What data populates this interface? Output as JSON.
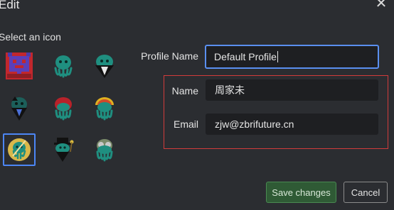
{
  "dialog": {
    "title": "Edit",
    "close_glyph": "✕"
  },
  "icons": {
    "label": "Select an icon",
    "items": [
      {
        "name": "pixel-creature-icon",
        "selected": false
      },
      {
        "name": "teal-squid-icon",
        "selected": false
      },
      {
        "name": "bearded-squid-icon",
        "selected": false
      },
      {
        "name": "dark-squid-icon",
        "selected": false
      },
      {
        "name": "red-squid-icon",
        "selected": false
      },
      {
        "name": "rainbow-squid-icon",
        "selected": false
      },
      {
        "name": "gold-squid-icon",
        "selected": true
      },
      {
        "name": "tophat-squid-icon",
        "selected": false
      },
      {
        "name": "goggles-squid-icon",
        "selected": false
      }
    ]
  },
  "form": {
    "profile_name_label": "Profile Name",
    "profile_name_value": "Default Profile",
    "name_label": "Name",
    "name_value": "周家未",
    "email_label": "Email",
    "email_value": "zjw@zbrifuture.cn"
  },
  "buttons": {
    "save_label": "Save changes",
    "cancel_label": "Cancel"
  },
  "colors": {
    "background": "#2b2d31",
    "input_bg": "#1e1f22",
    "focus_border": "#5a8ff0",
    "highlight_border": "#d23b3b",
    "save_bg": "#2f5a35",
    "save_border": "#4a8a52"
  }
}
